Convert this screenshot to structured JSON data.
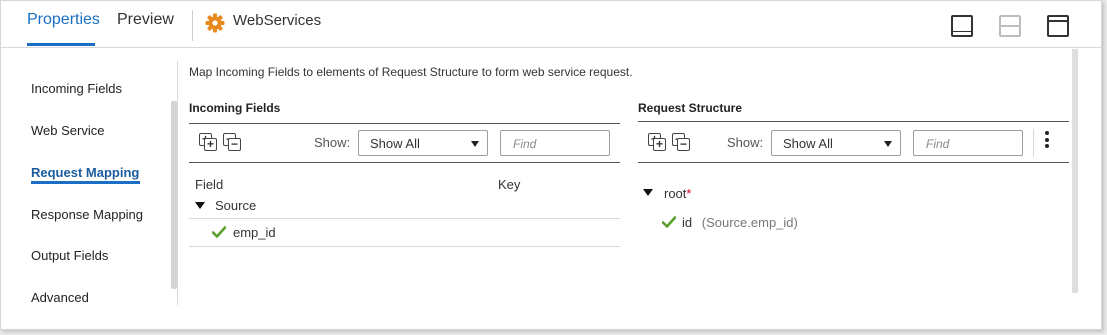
{
  "header": {
    "tabs": [
      {
        "label": "Properties",
        "active": true
      },
      {
        "label": "Preview",
        "active": false
      }
    ],
    "title": "WebServices",
    "title_icon": "gear-icon",
    "accent_color": "#1a6fc4",
    "layout_icons": [
      "layout-bottom-panel-icon",
      "layout-split-icon",
      "layout-top-panel-icon"
    ]
  },
  "nav": {
    "items": [
      {
        "label": "Incoming Fields",
        "active": false
      },
      {
        "label": "Web Service",
        "active": false
      },
      {
        "label": "Request Mapping",
        "active": true
      },
      {
        "label": "Response Mapping",
        "active": false
      },
      {
        "label": "Output Fields",
        "active": false
      },
      {
        "label": "Advanced",
        "active": false
      }
    ]
  },
  "description": "Map Incoming Fields to elements of Request Structure to form web service request.",
  "incoming": {
    "title": "Incoming Fields",
    "show_label": "Show:",
    "show_value": "Show All",
    "find_placeholder": "Find",
    "columns": [
      "Field",
      "Key"
    ],
    "tree": {
      "group": "Source",
      "fields": [
        "emp_id"
      ]
    }
  },
  "request": {
    "title": "Request Structure",
    "show_label": "Show:",
    "show_value": "Show All",
    "find_placeholder": "Find",
    "root_label": "root",
    "root_required": "*",
    "child": {
      "name": "id",
      "mapping": "(Source.emp_id)"
    }
  },
  "colors": {
    "check": "#5aa02c",
    "required": "#d0021b",
    "gear": "#e8891d"
  }
}
